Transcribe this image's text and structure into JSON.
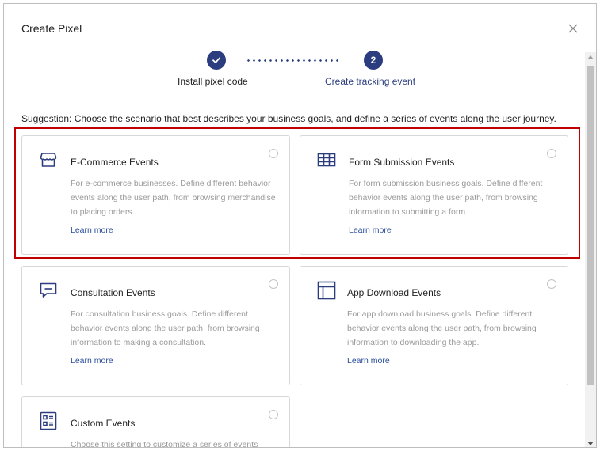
{
  "dialog": {
    "title": "Create Pixel"
  },
  "stepper": {
    "step1": {
      "label": "Install pixel code",
      "status": "completed"
    },
    "step2": {
      "number": "2",
      "label": "Create tracking event",
      "status": "active"
    }
  },
  "suggestion": "Suggestion: Choose the scenario that best describes your business goals, and define a series of events along the user journey.",
  "cards": [
    {
      "title": "E-Commerce Events",
      "icon": "storefront-icon",
      "description": "For e-commerce businesses. Define different behavior events along the user path, from browsing merchandise to placing orders.",
      "link": "Learn more"
    },
    {
      "title": "Form Submission Events",
      "icon": "form-table-icon",
      "description": "For form submission business goals. Define different behavior events along the user path, from browsing information to submitting a form.",
      "link": "Learn more"
    },
    {
      "title": "Consultation Events",
      "icon": "chat-bubble-icon",
      "description": "For consultation business goals. Define different behavior events along the user path, from browsing information to making a consultation.",
      "link": "Learn more"
    },
    {
      "title": "App Download Events",
      "icon": "app-window-icon",
      "description": "For app download business goals. Define different behavior events along the user path, from browsing information to downloading the app.",
      "link": "Learn more"
    },
    {
      "title": "Custom Events",
      "icon": "list-settings-icon",
      "description": "Choose this setting to customize a series of events",
      "link": ""
    }
  ],
  "colors": {
    "primary": "#2b3d7e",
    "link": "#2b4d9a",
    "highlight_border": "#c00000",
    "muted_text": "#9a9a9a"
  }
}
